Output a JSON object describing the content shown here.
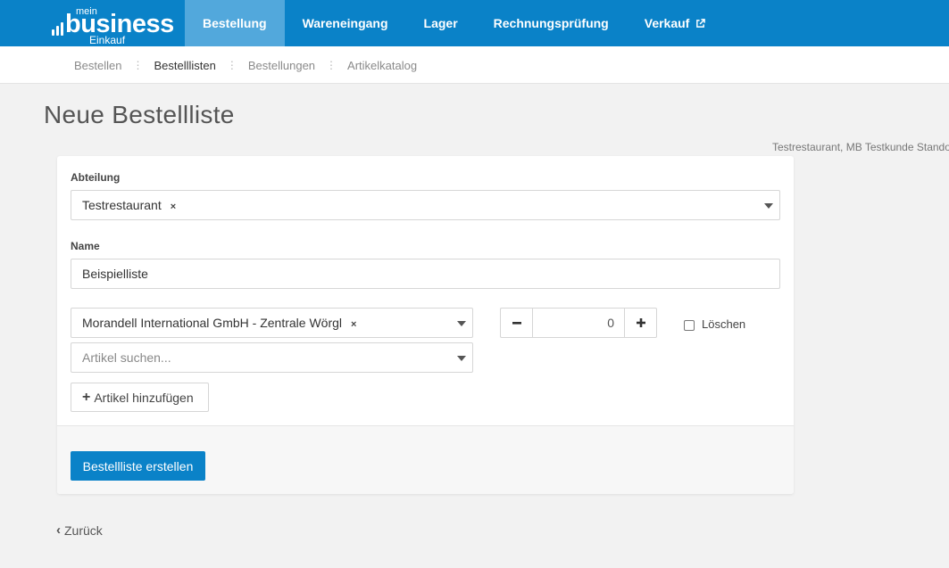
{
  "brand": {
    "mein": "mein",
    "name": "business",
    "sub": "Einkauf"
  },
  "nav": {
    "items": [
      "Bestellung",
      "Wareneingang",
      "Lager",
      "Rechnungsprüfung",
      "Verkauf"
    ],
    "active": "Bestellung",
    "external_icon": "external-link-icon"
  },
  "subnav": {
    "items": [
      "Bestellen",
      "Bestelllisten",
      "Bestellungen",
      "Artikelkatalog"
    ],
    "active": "Bestelllisten"
  },
  "page": {
    "title": "Neue Bestellliste",
    "customer": "Testrestaurant, MB Testkunde Standort"
  },
  "form": {
    "abteilung_label": "Abteilung",
    "abteilung_value": "Testrestaurant",
    "name_label": "Name",
    "name_value": "Beispielliste",
    "supplier_value": "Morandell International GmbH - Zentrale Wörgl",
    "article_placeholder": "Artikel suchen...",
    "quantity": "0",
    "delete_label": "Löschen",
    "add_article_label": "Artikel hinzufügen",
    "submit_label": "Bestellliste erstellen",
    "clear_symbol": "×"
  },
  "back_label": "Zurück",
  "colors": {
    "primary": "#0a82c8",
    "nav_active": "#52a8dc",
    "background": "#f2f2f2"
  }
}
